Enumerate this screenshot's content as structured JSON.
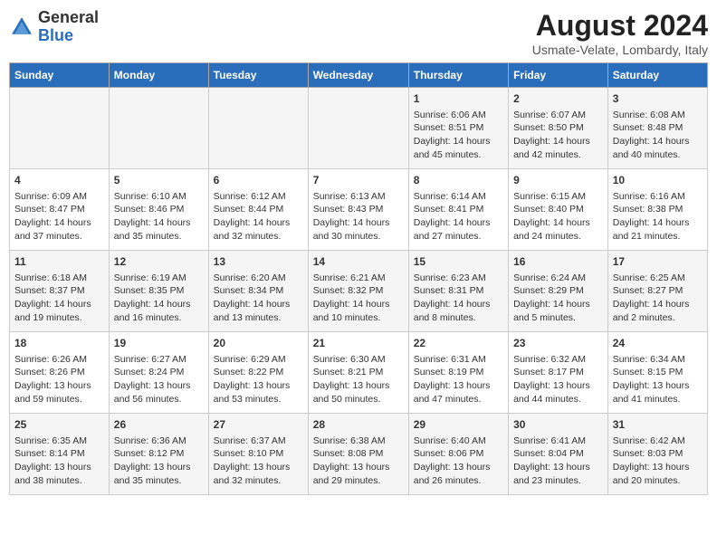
{
  "header": {
    "logo_general": "General",
    "logo_blue": "Blue",
    "month_year": "August 2024",
    "location": "Usmate-Velate, Lombardy, Italy"
  },
  "weekdays": [
    "Sunday",
    "Monday",
    "Tuesday",
    "Wednesday",
    "Thursday",
    "Friday",
    "Saturday"
  ],
  "weeks": [
    [
      {
        "day": "",
        "info": ""
      },
      {
        "day": "",
        "info": ""
      },
      {
        "day": "",
        "info": ""
      },
      {
        "day": "",
        "info": ""
      },
      {
        "day": "1",
        "info": "Sunrise: 6:06 AM\nSunset: 8:51 PM\nDaylight: 14 hours and 45 minutes."
      },
      {
        "day": "2",
        "info": "Sunrise: 6:07 AM\nSunset: 8:50 PM\nDaylight: 14 hours and 42 minutes."
      },
      {
        "day": "3",
        "info": "Sunrise: 6:08 AM\nSunset: 8:48 PM\nDaylight: 14 hours and 40 minutes."
      }
    ],
    [
      {
        "day": "4",
        "info": "Sunrise: 6:09 AM\nSunset: 8:47 PM\nDaylight: 14 hours and 37 minutes."
      },
      {
        "day": "5",
        "info": "Sunrise: 6:10 AM\nSunset: 8:46 PM\nDaylight: 14 hours and 35 minutes."
      },
      {
        "day": "6",
        "info": "Sunrise: 6:12 AM\nSunset: 8:44 PM\nDaylight: 14 hours and 32 minutes."
      },
      {
        "day": "7",
        "info": "Sunrise: 6:13 AM\nSunset: 8:43 PM\nDaylight: 14 hours and 30 minutes."
      },
      {
        "day": "8",
        "info": "Sunrise: 6:14 AM\nSunset: 8:41 PM\nDaylight: 14 hours and 27 minutes."
      },
      {
        "day": "9",
        "info": "Sunrise: 6:15 AM\nSunset: 8:40 PM\nDaylight: 14 hours and 24 minutes."
      },
      {
        "day": "10",
        "info": "Sunrise: 6:16 AM\nSunset: 8:38 PM\nDaylight: 14 hours and 21 minutes."
      }
    ],
    [
      {
        "day": "11",
        "info": "Sunrise: 6:18 AM\nSunset: 8:37 PM\nDaylight: 14 hours and 19 minutes."
      },
      {
        "day": "12",
        "info": "Sunrise: 6:19 AM\nSunset: 8:35 PM\nDaylight: 14 hours and 16 minutes."
      },
      {
        "day": "13",
        "info": "Sunrise: 6:20 AM\nSunset: 8:34 PM\nDaylight: 14 hours and 13 minutes."
      },
      {
        "day": "14",
        "info": "Sunrise: 6:21 AM\nSunset: 8:32 PM\nDaylight: 14 hours and 10 minutes."
      },
      {
        "day": "15",
        "info": "Sunrise: 6:23 AM\nSunset: 8:31 PM\nDaylight: 14 hours and 8 minutes."
      },
      {
        "day": "16",
        "info": "Sunrise: 6:24 AM\nSunset: 8:29 PM\nDaylight: 14 hours and 5 minutes."
      },
      {
        "day": "17",
        "info": "Sunrise: 6:25 AM\nSunset: 8:27 PM\nDaylight: 14 hours and 2 minutes."
      }
    ],
    [
      {
        "day": "18",
        "info": "Sunrise: 6:26 AM\nSunset: 8:26 PM\nDaylight: 13 hours and 59 minutes."
      },
      {
        "day": "19",
        "info": "Sunrise: 6:27 AM\nSunset: 8:24 PM\nDaylight: 13 hours and 56 minutes."
      },
      {
        "day": "20",
        "info": "Sunrise: 6:29 AM\nSunset: 8:22 PM\nDaylight: 13 hours and 53 minutes."
      },
      {
        "day": "21",
        "info": "Sunrise: 6:30 AM\nSunset: 8:21 PM\nDaylight: 13 hours and 50 minutes."
      },
      {
        "day": "22",
        "info": "Sunrise: 6:31 AM\nSunset: 8:19 PM\nDaylight: 13 hours and 47 minutes."
      },
      {
        "day": "23",
        "info": "Sunrise: 6:32 AM\nSunset: 8:17 PM\nDaylight: 13 hours and 44 minutes."
      },
      {
        "day": "24",
        "info": "Sunrise: 6:34 AM\nSunset: 8:15 PM\nDaylight: 13 hours and 41 minutes."
      }
    ],
    [
      {
        "day": "25",
        "info": "Sunrise: 6:35 AM\nSunset: 8:14 PM\nDaylight: 13 hours and 38 minutes."
      },
      {
        "day": "26",
        "info": "Sunrise: 6:36 AM\nSunset: 8:12 PM\nDaylight: 13 hours and 35 minutes."
      },
      {
        "day": "27",
        "info": "Sunrise: 6:37 AM\nSunset: 8:10 PM\nDaylight: 13 hours and 32 minutes."
      },
      {
        "day": "28",
        "info": "Sunrise: 6:38 AM\nSunset: 8:08 PM\nDaylight: 13 hours and 29 minutes."
      },
      {
        "day": "29",
        "info": "Sunrise: 6:40 AM\nSunset: 8:06 PM\nDaylight: 13 hours and 26 minutes."
      },
      {
        "day": "30",
        "info": "Sunrise: 6:41 AM\nSunset: 8:04 PM\nDaylight: 13 hours and 23 minutes."
      },
      {
        "day": "31",
        "info": "Sunrise: 6:42 AM\nSunset: 8:03 PM\nDaylight: 13 hours and 20 minutes."
      }
    ]
  ]
}
